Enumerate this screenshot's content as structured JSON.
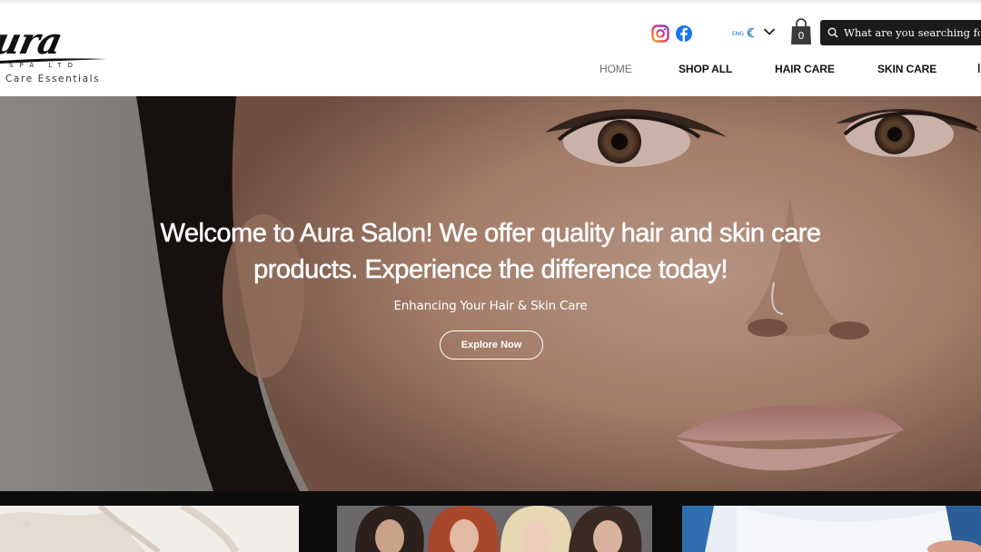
{
  "brand": {
    "logo_script": "ura",
    "logo_spa": "SPA LTD",
    "logo_tagline": "Care Essentials"
  },
  "header": {
    "social": [
      {
        "icon": "instagram-icon"
      },
      {
        "icon": "facebook-icon"
      }
    ],
    "language": {
      "flag_text": "ENG",
      "icon": "chevron-down-icon"
    },
    "cart": {
      "count": "0",
      "icon": "shopping-bag-icon"
    },
    "search": {
      "placeholder": "What are you searching for?",
      "icon": "search-icon"
    },
    "nav": {
      "home": "HOME",
      "shop_all": "SHOP ALL",
      "hair_care": "HAIR CARE",
      "skin_care": "SKIN CARE"
    }
  },
  "hero": {
    "title": "Welcome to Aura Salon! We offer quality hair and skin care products. Experience the difference today!",
    "subtitle": "Enhancing Your Hair & Skin Care",
    "button": "Explore Now"
  },
  "colors": {
    "search_bg": "#1b1b1b",
    "nav_active": "#6d6d6d",
    "strip": "#0c0c0c"
  }
}
